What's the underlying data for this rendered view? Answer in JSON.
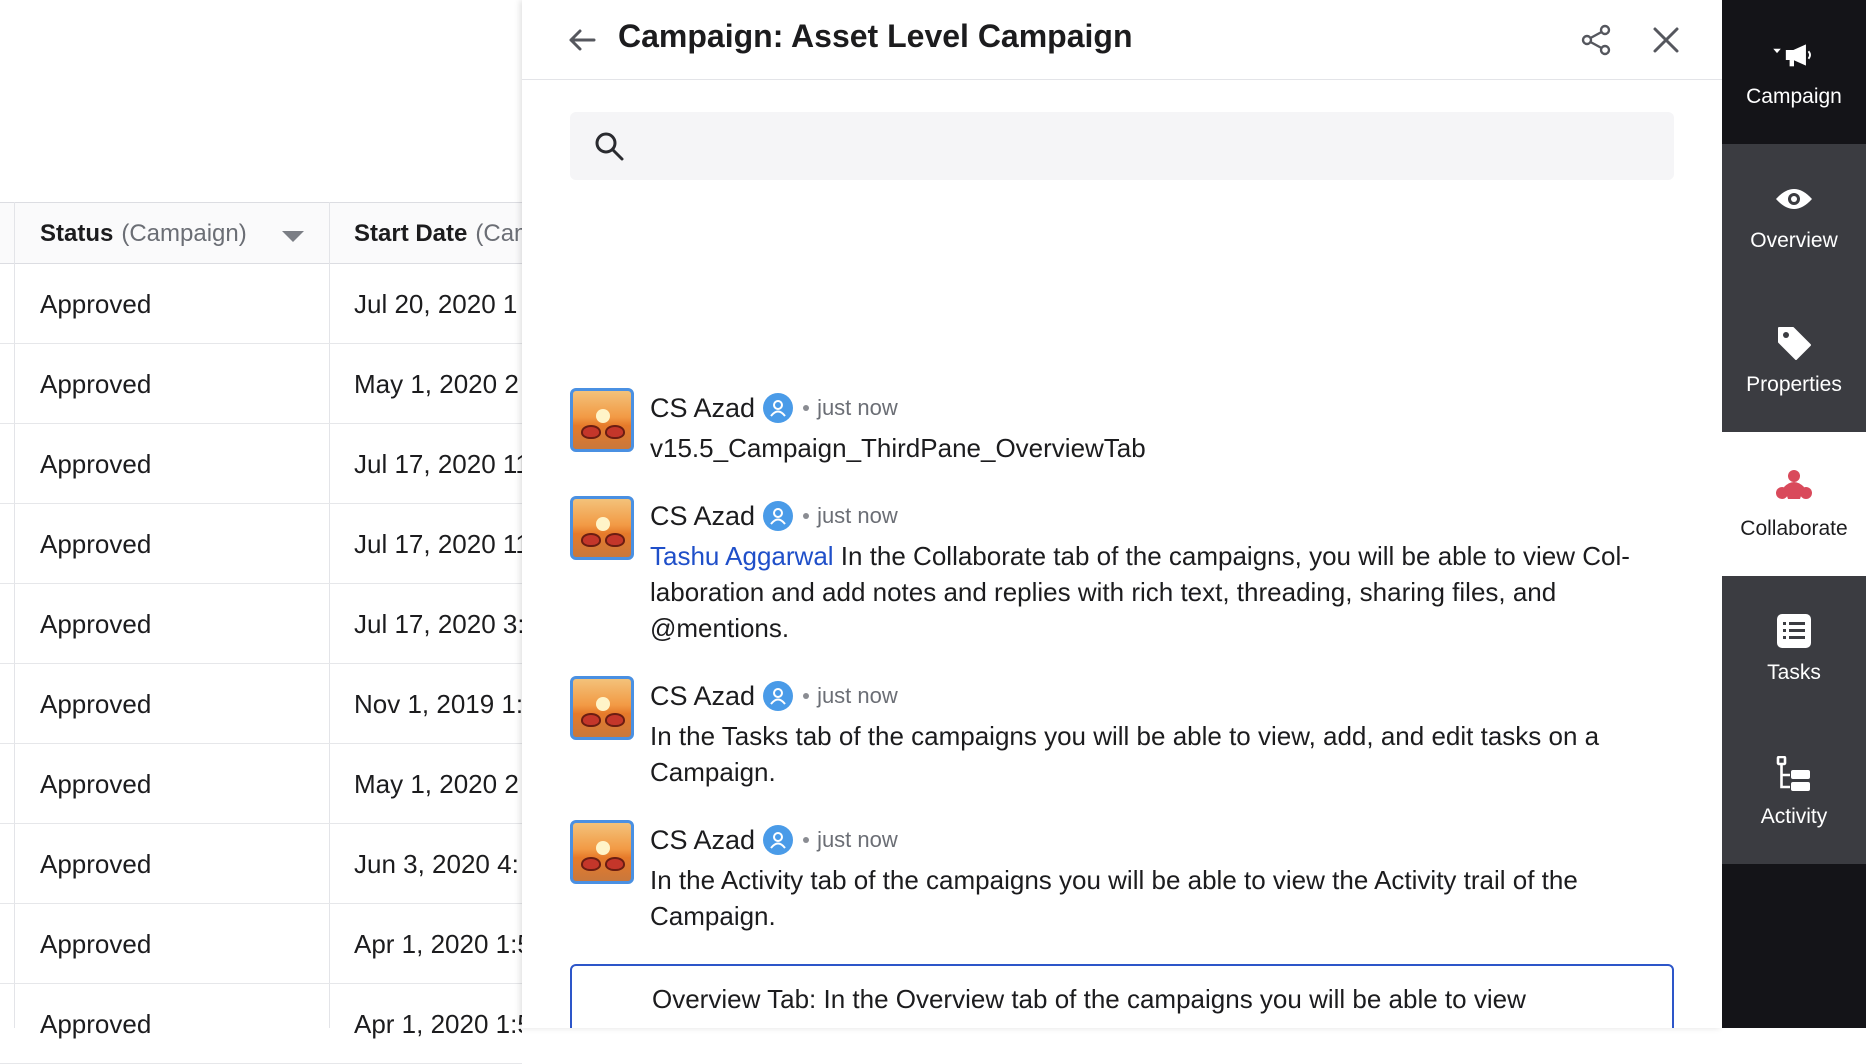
{
  "table": {
    "columns": [
      {
        "label": "Status",
        "sub": "(Campaign)"
      },
      {
        "label": "Start Date",
        "sub": "(Campaign)"
      }
    ],
    "rows": [
      {
        "status": "Approved",
        "start": "Jul 20, 2020 1"
      },
      {
        "status": "Approved",
        "start": "May 1, 2020 2"
      },
      {
        "status": "Approved",
        "start": "Jul 17, 2020 11"
      },
      {
        "status": "Approved",
        "start": "Jul 17, 2020 11"
      },
      {
        "status": "Approved",
        "start": "Jul 17, 2020 3:"
      },
      {
        "status": "Approved",
        "start": "Nov 1, 2019 1:3"
      },
      {
        "status": "Approved",
        "start": "May 1, 2020 2"
      },
      {
        "status": "Approved",
        "start": "Jun 3, 2020 4:"
      },
      {
        "status": "Approved",
        "start": "Apr 1, 2020 1:5"
      },
      {
        "status": "Approved",
        "start": "Apr 1, 2020 1:5"
      }
    ]
  },
  "panel": {
    "title": "Campaign: Asset Level Campaign",
    "search_placeholder": ""
  },
  "notes": [
    {
      "author": "CS Azad",
      "time": "just now",
      "mention": "",
      "text": "v15.5_Campaign_ThirdPane_OverviewTab"
    },
    {
      "author": "CS Azad",
      "time": "just now",
      "mention": "Tashu Aggarwal",
      "text": " In the Collaborate tab of the campaigns, you will be able to view Col-laboration and add notes and replies with rich text, threading, sharing files, and @mentions."
    },
    {
      "author": "CS Azad",
      "time": "just now",
      "mention": "",
      "text": "In the Tasks tab of the campaigns you will be able to view, add, and edit tasks on a Campaign."
    },
    {
      "author": "CS Azad",
      "time": "just now",
      "mention": "",
      "text": "In the Activity tab of the campaigns you will be able to view the Activity trail of the Campaign."
    }
  ],
  "editor": {
    "text": "Overview Tab: In the Overview tab of the campaigns you will be able to view"
  },
  "rail": {
    "campaign": "Campaign",
    "overview": "Overview",
    "properties": "Properties",
    "collaborate": "Collaborate",
    "tasks": "Tasks",
    "activity": "Activity"
  },
  "colors": {
    "accent_blue": "#2d56c9",
    "mention_blue": "#1f4fc9",
    "collaborate_icon": "#d94a5b",
    "rail_bg": "#3b3c41"
  },
  "icons": [
    "back-arrow-icon",
    "share-icon",
    "close-icon",
    "search-icon",
    "megaphone-icon",
    "eye-icon",
    "tag-icon",
    "collaborate-icon",
    "tasks-icon",
    "activity-icon",
    "user-icon"
  ]
}
